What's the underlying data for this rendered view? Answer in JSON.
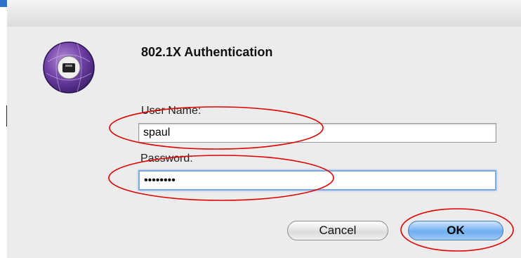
{
  "dialog": {
    "title": "802.1X Authentication",
    "username_label": "User Name:",
    "username_value": "spaul",
    "password_label": "Password:",
    "password_value": "••••••••",
    "cancel_label": "Cancel",
    "ok_label": "OK"
  },
  "icons": {
    "app": "network-ethernet-icon"
  },
  "annotations": {
    "highlight_color": "#e00000"
  },
  "colors": {
    "accent": "#6eaef0",
    "icon_purple": "#6d3fa5"
  }
}
